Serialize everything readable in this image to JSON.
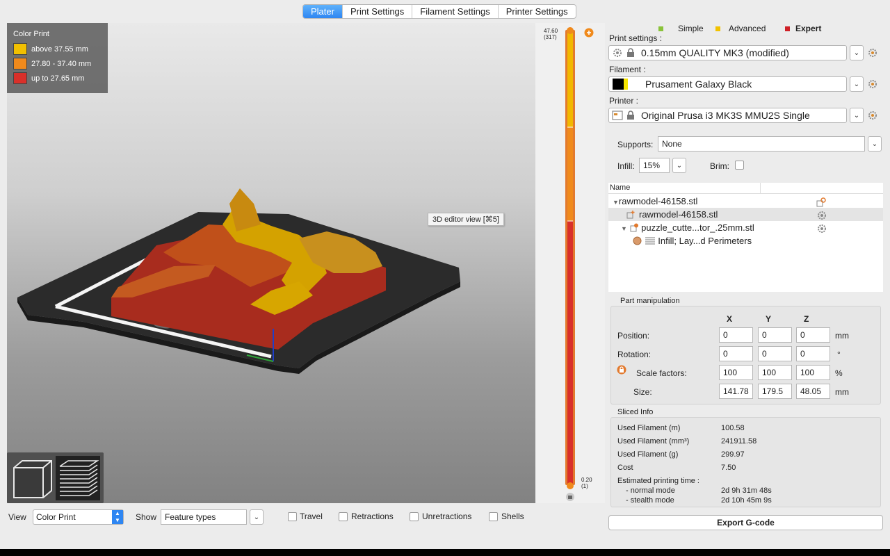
{
  "tabs": [
    "Plater",
    "Print Settings",
    "Filament Settings",
    "Printer Settings"
  ],
  "legend": {
    "title": "Color Print",
    "items": [
      {
        "label": "above 37.55 mm",
        "color": "#f2c000"
      },
      {
        "label": "27.80 - 37.40 mm",
        "color": "#f08a1c"
      },
      {
        "label": "up to 27.65 mm",
        "color": "#d9302a"
      }
    ]
  },
  "tooltip": "3D editor view [⌘5]",
  "slider": {
    "top_value": "47.60",
    "top_layer": "(317)",
    "bottom_value": "0.20",
    "bottom_layer": "(1)"
  },
  "modes": {
    "simple": {
      "label": "Simple",
      "color": "#8ac33a"
    },
    "advanced": {
      "label": "Advanced",
      "color": "#f2c200"
    },
    "expert": {
      "label": "Expert",
      "color": "#cf2127"
    }
  },
  "print_settings": {
    "label": "Print settings :",
    "value": "0.15mm QUALITY MK3 (modified)"
  },
  "filament": {
    "label": "Filament :",
    "value": "Prusament Galaxy Black"
  },
  "printer": {
    "label": "Printer :",
    "value": "Original Prusa i3 MK3S MMU2S Single"
  },
  "supports": {
    "label": "Supports:",
    "value": "None"
  },
  "infill": {
    "label": "Infill:",
    "value": "15%"
  },
  "brim": {
    "label": "Brim:"
  },
  "tree": {
    "header": "Name",
    "items": [
      "rawmodel-46158.stl",
      "rawmodel-46158.stl",
      "puzzle_cutte...tor_.25mm.stl",
      "Infill; Lay...d Perimeters"
    ]
  },
  "part_manipulation": {
    "title": "Part manipulation",
    "axes": [
      "X",
      "Y",
      "Z"
    ],
    "rows": [
      {
        "label": "Position:",
        "values": [
          "0",
          "0",
          "0"
        ],
        "unit": "mm"
      },
      {
        "label": "Rotation:",
        "values": [
          "0",
          "0",
          "0"
        ],
        "unit": "°"
      },
      {
        "label": "Scale factors:",
        "values": [
          "100",
          "100",
          "100"
        ],
        "unit": "%"
      },
      {
        "label": "Size:",
        "values": [
          "141.78",
          "179.5",
          "48.05"
        ],
        "unit": "mm"
      }
    ]
  },
  "sliced_info": {
    "title": "Sliced Info",
    "rows": [
      {
        "label": "Used Filament (m)",
        "value": "100.58"
      },
      {
        "label": "Used Filament (mm³)",
        "value": "241911.58"
      },
      {
        "label": "Used Filament (g)",
        "value": "299.97"
      },
      {
        "label": "Cost",
        "value": "7.50"
      }
    ],
    "time_label": "Estimated printing time :",
    "normal_label": "- normal mode",
    "normal_value": "2d 9h 31m 48s",
    "stealth_label": "- stealth mode",
    "stealth_value": "2d 10h 45m 9s"
  },
  "export_label": "Export G-code",
  "bottom": {
    "view_label": "View",
    "view_value": "Color Print",
    "show_label": "Show",
    "show_value": "Feature types",
    "checks": [
      "Travel",
      "Retractions",
      "Unretractions",
      "Shells"
    ]
  }
}
